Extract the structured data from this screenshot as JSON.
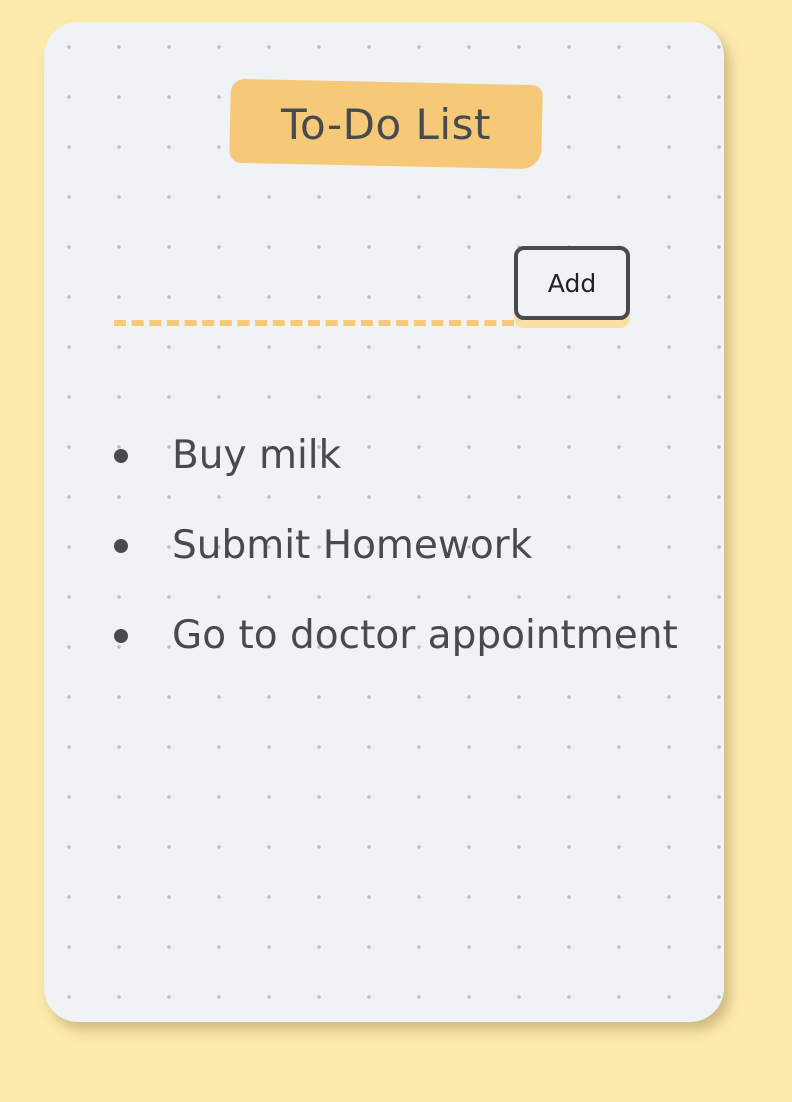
{
  "header": {
    "title": "To-Do List"
  },
  "form": {
    "input_value": "",
    "input_placeholder": "",
    "add_label": "Add"
  },
  "tasks": [
    {
      "text": "Buy milk"
    },
    {
      "text": "Submit Homework"
    },
    {
      "text": "Go to doctor appointment"
    }
  ],
  "colors": {
    "page_background": "#fdeaad",
    "card_background": "#f0f3f6",
    "accent": "#f5c977",
    "text": "#474a4f"
  }
}
